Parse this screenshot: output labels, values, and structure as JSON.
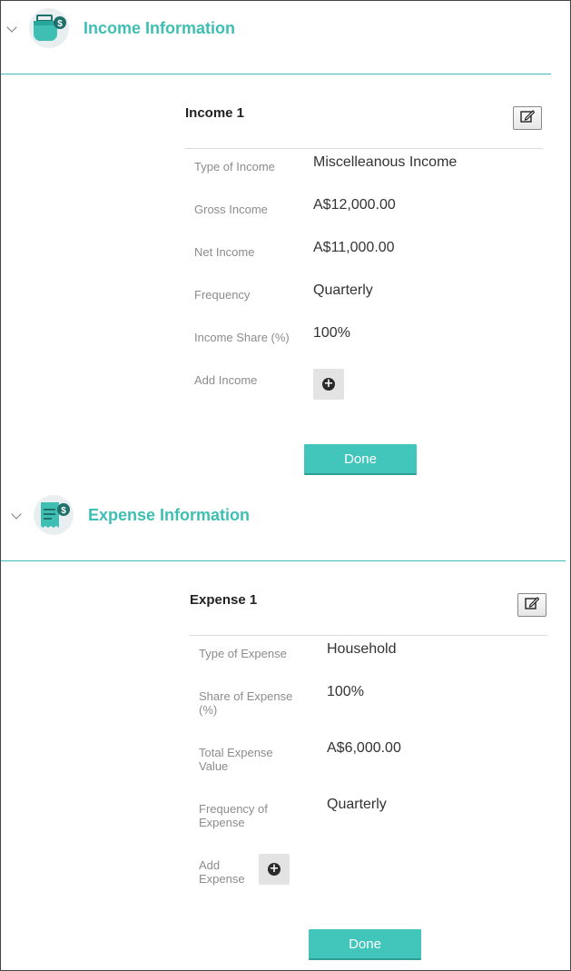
{
  "income": {
    "section_title": "Income Information",
    "card_title": "Income 1",
    "fields": [
      {
        "label": "Type of Income",
        "value": "Miscelleanous Income"
      },
      {
        "label": "Gross Income",
        "value": "A$12,000.00"
      },
      {
        "label": "Net Income",
        "value": "A$11,000.00"
      },
      {
        "label": "Frequency",
        "value": "Quarterly"
      },
      {
        "label": "Income Share (%)",
        "value": "100%"
      }
    ],
    "add_label": "Add Income",
    "done_label": "Done"
  },
  "expense": {
    "section_title": "Expense Information",
    "card_title": "Expense 1",
    "fields": [
      {
        "label": "Type of Expense",
        "value": "Household"
      },
      {
        "label": "Share of Expense (%)",
        "value": "100%"
      },
      {
        "label": "Total Expense Value",
        "value": "A$6,000.00"
      },
      {
        "label": "Frequency of Expense",
        "value": "Quarterly"
      }
    ],
    "add_label": "Add Expense",
    "done_label": "Done"
  },
  "icons": {
    "collapse": "chevron-down-icon",
    "income": "wallet-dollar-icon",
    "expense": "receipt-dollar-icon",
    "edit": "edit-icon",
    "add": "plus-circle-icon"
  },
  "colors": {
    "accent": "#3fbfb4",
    "done_button": "#42c5bb",
    "icon_dark": "#1f6f6a"
  }
}
